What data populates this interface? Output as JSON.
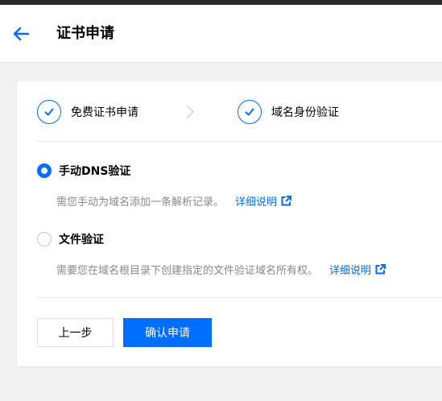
{
  "header": {
    "title": "证书申请"
  },
  "steps": [
    {
      "label": "免费证书申请"
    },
    {
      "label": "域名身份验证"
    }
  ],
  "options": [
    {
      "label": "手动DNS验证",
      "description": "需您手动为域名添加一条解析记录。",
      "link": "详细说明",
      "selected": true
    },
    {
      "label": "文件验证",
      "description": "需要您在域名根目录下创建指定的文件验证域名所有权。",
      "link": "详细说明",
      "selected": false
    }
  ],
  "buttons": {
    "prev": "上一步",
    "confirm": "确认申请"
  },
  "colors": {
    "accent": "#006eff",
    "muted_text": "#888888"
  }
}
